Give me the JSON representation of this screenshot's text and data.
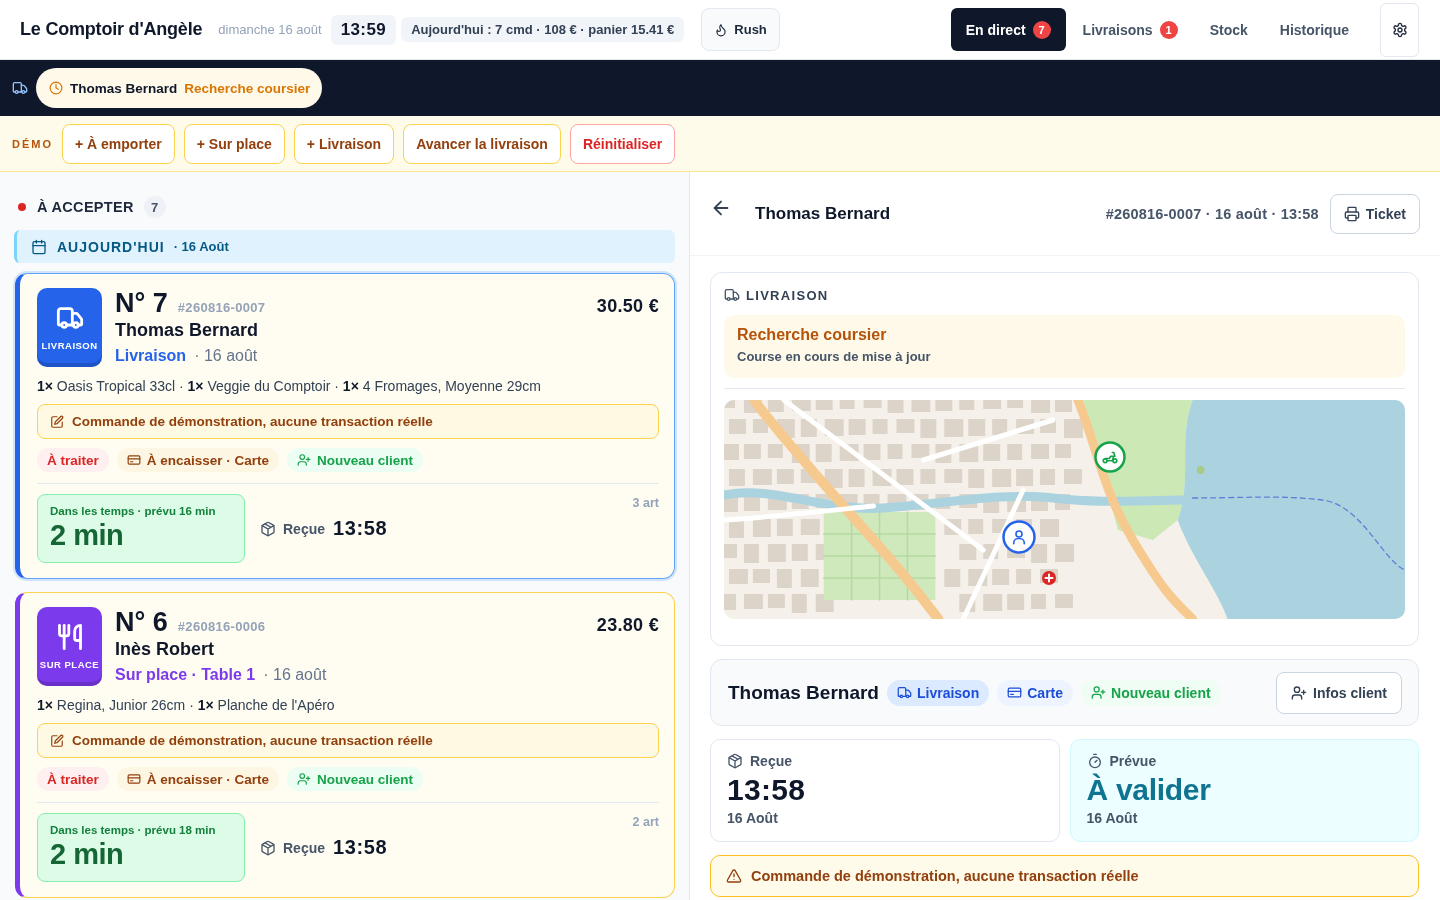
{
  "header": {
    "brand": "Le Comptoir d'Angèle",
    "date": "dimanche 16 août",
    "clock": "13:59",
    "summary": "Aujourd'hui : 7 cmd · 108 € · panier 15.41 €",
    "rush_button": "Rush",
    "nav": [
      {
        "label": "En direct",
        "badge": "7",
        "selected": true
      },
      {
        "label": "Livraisons",
        "badge": "1",
        "selected": false
      },
      {
        "label": "Stock",
        "selected": false
      },
      {
        "label": "Historique",
        "selected": false
      }
    ]
  },
  "courier_bar": {
    "chips": [
      {
        "customer": "Thomas Bernard",
        "status": "Recherche coursier"
      }
    ]
  },
  "demo_bar": {
    "label": "DÉMO",
    "buttons": [
      {
        "label": "+ À emporter",
        "kind": "action"
      },
      {
        "label": "+ Sur place",
        "kind": "action"
      },
      {
        "label": "+ Livraison",
        "kind": "action"
      },
      {
        "label": "Avancer la livraison",
        "kind": "action"
      },
      {
        "label": "Réinitialiser",
        "kind": "reset"
      }
    ]
  },
  "queue": {
    "title": "À ACCEPTER",
    "count": "7",
    "day": {
      "label": "AUJOURD'HUI",
      "date": "· 16 Août"
    },
    "orders": [
      {
        "kind": "delivery",
        "selected": true,
        "type_label": "LIVRAISON",
        "number": "N° 7",
        "ref": "#260816-0007",
        "total": "30.50 €",
        "customer": "Thomas Bernard",
        "mode": "Livraison",
        "date": "· 16 août",
        "items": "**1×** Oasis Tropical 33cl · **1×** Veggie du Comptoir · **1×** 4 Fromages, Moyenne 29cm",
        "note": "Commande de démonstration, aucune transaction réelle",
        "tags": [
          {
            "kind": "status",
            "label": "À traiter"
          },
          {
            "kind": "payment",
            "label": "À encaisser · Carte"
          },
          {
            "kind": "new-client",
            "label": "Nouveau client"
          }
        ],
        "timer_status": "Dans les temps · prévu 16 min",
        "timer": "2 min",
        "received_label": "Reçue",
        "received_time": "13:58",
        "article_count": "3 art"
      },
      {
        "kind": "dine-in",
        "selected": false,
        "type_label": "SUR PLACE",
        "number": "N° 6",
        "ref": "#260816-0006",
        "total": "23.80 €",
        "customer": "Inès Robert",
        "mode": "Sur place · Table 1",
        "date": "· 16 août",
        "items": "**1×** Regina, Junior 26cm · **1×** Planche de l'Apéro",
        "note": "Commande de démonstration, aucune transaction réelle",
        "tags": [
          {
            "kind": "status",
            "label": "À traiter"
          },
          {
            "kind": "payment",
            "label": "À encaisser · Carte"
          },
          {
            "kind": "new-client",
            "label": "Nouveau client"
          }
        ],
        "timer_status": "Dans les temps · prévu 18 min",
        "timer": "2 min",
        "received_label": "Reçue",
        "received_time": "13:58",
        "article_count": "2 art"
      }
    ]
  },
  "detail": {
    "title": "Thomas Bernard",
    "meta": "#260816-0007 · 16 août · 13:58",
    "ticket_button": "Ticket",
    "delivery": {
      "heading": "LIVRAISON",
      "status": "Recherche coursier",
      "substatus": "Course en cours de mise à jour"
    },
    "customer": {
      "name": "Thomas Bernard",
      "tags": [
        {
          "kind": "mode",
          "label": "Livraison"
        },
        {
          "kind": "payment",
          "label": "Carte"
        },
        {
          "kind": "new-client",
          "label": "Nouveau client"
        }
      ],
      "info_button": "Infos client"
    },
    "times": [
      {
        "kind": "received",
        "label": "Reçue",
        "value": "13:58",
        "date": "16 Août"
      },
      {
        "kind": "planned",
        "label": "Prévue",
        "value": "À valider",
        "date": "16 Août"
      }
    ],
    "warning": "Commande de démonstration, aucune transaction réelle"
  }
}
